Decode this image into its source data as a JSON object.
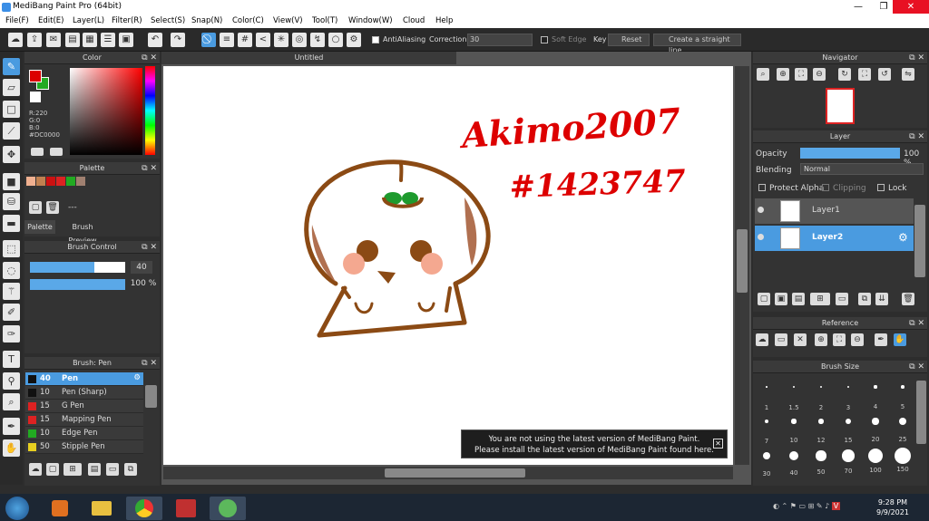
{
  "window": {
    "title": "MediBang Paint Pro (64bit)",
    "min": "—",
    "max": "❐",
    "close": "✕"
  },
  "menu": [
    "File(F)",
    "Edit(E)",
    "Layer(L)",
    "Filter(R)",
    "Select(S)",
    "Snap(N)",
    "Color(C)",
    "View(V)",
    "Tool(T)",
    "Window(W)",
    "Cloud",
    "Help"
  ],
  "toolbar": {
    "antialiasing": "AntiAliasing",
    "correction": "Correction",
    "correction_value": "30",
    "soft_edge": "Soft Edge",
    "key": "Key",
    "reset": "Reset",
    "straight_line": "Create a straight line"
  },
  "color_panel": {
    "title": "Color",
    "r": "R:220",
    "g": "G:0",
    "b": "B:0",
    "hex": "#DC0000",
    "primary": "#dc0000",
    "secondary": "#22aa22"
  },
  "palette_panel": {
    "title": "Palette",
    "tabs": [
      "Palette",
      "Brush Preview"
    ],
    "dash": "---",
    "swatches": [
      "#f0b090",
      "#c08050",
      "#cc1111",
      "#dd2222",
      "#22aa22",
      "#a08070"
    ]
  },
  "brush_control": {
    "title": "Brush Control",
    "size": "40",
    "opacity": "100 %",
    "size_fraction": 0.68,
    "opacity_fraction": 1.0
  },
  "brush_panel": {
    "title": "Brush: Pen",
    "items": [
      {
        "size": "40",
        "name": "Pen",
        "color": "#111111"
      },
      {
        "size": "10",
        "name": "Pen (Sharp)",
        "color": "#111111"
      },
      {
        "size": "15",
        "name": "G Pen",
        "color": "#dd2222"
      },
      {
        "size": "15",
        "name": "Mapping Pen",
        "color": "#dd2222"
      },
      {
        "size": "10",
        "name": "Edge Pen",
        "color": "#22aa22"
      },
      {
        "size": "50",
        "name": "Stipple Pen",
        "color": "#e8d020"
      }
    ]
  },
  "canvas": {
    "tab": "Untitled",
    "text1": "Akimo2007",
    "text2": "#1423747"
  },
  "navigator": {
    "title": "Navigator"
  },
  "layer_panel": {
    "title": "Layer",
    "opacity_label": "Opacity",
    "opacity": "100 %",
    "opacity_fraction": 1.0,
    "blending_label": "Blending",
    "blending": "Normal",
    "protect_alpha": "Protect Alpha",
    "clipping": "Clipping",
    "lock": "Lock",
    "layers": [
      "Layer1",
      "Layer2"
    ]
  },
  "reference": {
    "title": "Reference"
  },
  "brush_size": {
    "title": "Brush Size",
    "sizes": [
      "1",
      "1.5",
      "2",
      "3",
      "4",
      "5",
      "7",
      "10",
      "12",
      "15",
      "20",
      "25",
      "30",
      "40",
      "50",
      "70",
      "100",
      "150"
    ]
  },
  "notification": {
    "line1": "You are not using the latest version of MediBang Paint.",
    "line2": "Please install the latest version of MediBang Paint found here."
  },
  "taskbar": {
    "time": "9:28 PM",
    "date": "9/9/2021"
  }
}
